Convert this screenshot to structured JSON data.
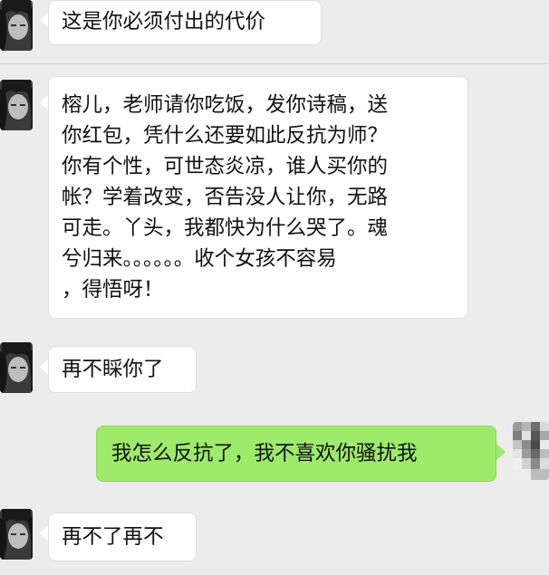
{
  "messages": [
    {
      "sender": "contact",
      "text": "这是你必须付出的代价"
    },
    {
      "sender": "contact",
      "lines": [
        "榕儿，老师请你吃饭，发你诗稿，送",
        "你红包，凭什么还要如此反抗为师？",
        "你有个性，可世态炎凉，谁人买你的",
        "帐？学着改变，否告没人让你，无路",
        "可走。丫头，我都快为什么哭了。魂",
        "兮归来。。。。。。收个女孩不容易",
        "，得悟呀！"
      ]
    },
    {
      "sender": "contact",
      "text": "再不睬你了"
    },
    {
      "sender": "me",
      "text": "我怎么反抗了，我不喜欢你骚扰我"
    },
    {
      "sender": "contact",
      "text": "再不了再不"
    }
  ],
  "colors": {
    "background": "#ececec",
    "incoming_bubble": "#ffffff",
    "outgoing_bubble": "#9eea6a"
  },
  "icons": {
    "contact_avatar": "contact-avatar-icon",
    "user_avatar": "user-avatar-icon"
  }
}
